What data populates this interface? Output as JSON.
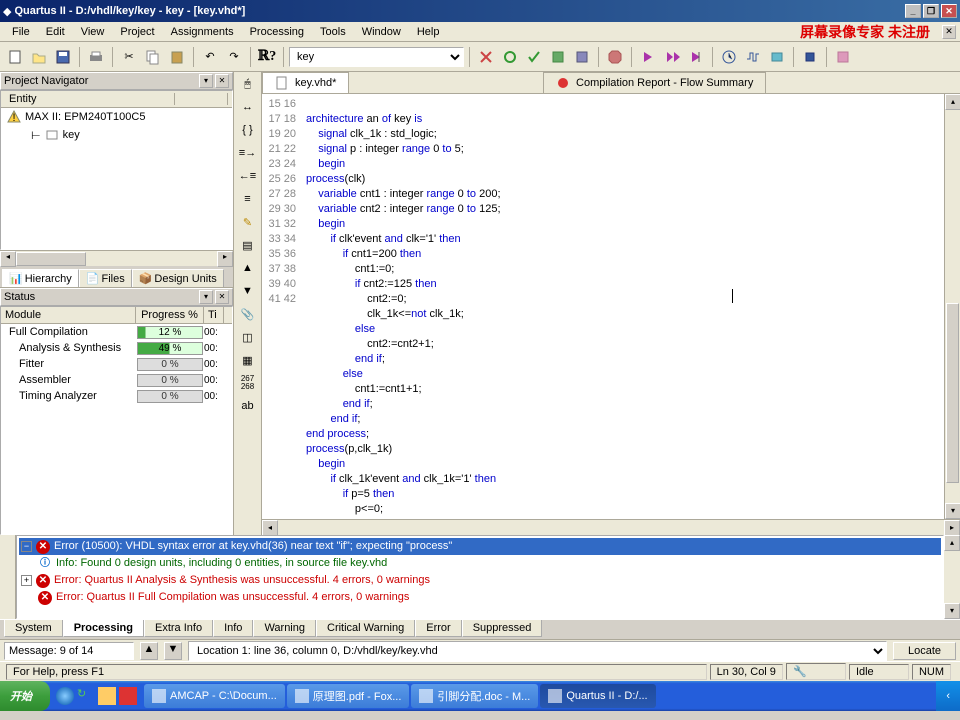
{
  "window": {
    "title": "Quartus II - D:/vhdl/key/key - key - [key.vhd*]"
  },
  "menu": {
    "items": [
      "File",
      "Edit",
      "View",
      "Project",
      "Assignments",
      "Processing",
      "Tools",
      "Window",
      "Help"
    ],
    "brand": "屏幕录像专家 未注册"
  },
  "toolbar": {
    "file_selector": "key"
  },
  "project_nav": {
    "title": "Project Navigator",
    "entity_header": "Entity",
    "device": "MAX II: EPM240T100C5",
    "entity": "key",
    "tabs": [
      "Hierarchy",
      "Files",
      "Design Units"
    ]
  },
  "status": {
    "title": "Status",
    "headers": [
      "Module",
      "Progress %",
      "Ti"
    ],
    "rows": [
      {
        "name": "Full Compilation",
        "progress": "12 %",
        "cls": "green",
        "time": "00:"
      },
      {
        "name": "Analysis & Synthesis",
        "progress": "49 %",
        "cls": "green2",
        "time": "00:",
        "indent": true
      },
      {
        "name": "Fitter",
        "progress": "0 %",
        "cls": "grey",
        "time": "00:",
        "indent": true
      },
      {
        "name": "Assembler",
        "progress": "0 %",
        "cls": "grey",
        "time": "00:",
        "indent": true
      },
      {
        "name": "Timing Analyzer",
        "progress": "0 %",
        "cls": "grey",
        "time": "00:",
        "indent": true
      }
    ]
  },
  "editor": {
    "tabs": [
      {
        "label": "key.vhd*",
        "active": true
      },
      {
        "label": "Compilation Report - Flow Summary",
        "active": false
      }
    ],
    "line_start": 15,
    "line_end": 42,
    "code_lines": [
      "",
      "<span class='kw'>architecture</span> an <span class='kw'>of</span> key <span class='kw'>is</span>",
      "    <span class='kw'>signal</span> clk_1k : std_logic;",
      "    <span class='kw'>signal</span> p : integer <span class='kw'>range</span> 0 <span class='kw'>to</span> 5;",
      "    <span class='kw'>begin</span>",
      "<span class='kw'>process</span>(clk)",
      "    <span class='kw'>variable</span> cnt1 : integer <span class='kw'>range</span> 0 <span class='kw'>to</span> 200;",
      "    <span class='kw'>variable</span> cnt2 : integer <span class='kw'>range</span> 0 <span class='kw'>to</span> 125;",
      "    <span class='kw'>begin</span>",
      "        <span class='kw'>if</span> clk'event <span class='kw'>and</span> clk='1' <span class='kw'>then</span>",
      "            <span class='kw'>if</span> cnt1=200 <span class='kw'>then</span>",
      "                cnt1:=0;",
      "                <span class='kw'>if</span> cnt2:=125 <span class='kw'>then</span>",
      "                    cnt2:=0;",
      "                    clk_1k<=<span class='kw'>not</span> clk_1k;",
      "                <span class='kw'>else</span>",
      "                    cnt2:=cnt2+1;",
      "                <span class='kw'>end</span> <span class='kw'>if</span>;",
      "            <span class='kw'>else</span>",
      "                cnt1:=cnt1+1;",
      "            <span class='kw'>end</span> <span class='kw'>if</span>;",
      "        <span class='kw'>end</span> <span class='kw'>if</span>;",
      "<span class='kw'>end</span> <span class='kw'>process</span>;",
      "<span class='kw'>process</span>(p,clk_1k)",
      "    <span class='kw'>begin</span>",
      "        <span class='kw'>if</span> clk_1k'event <span class='kw'>and</span> clk_1k='1' <span class='kw'>then</span>",
      "            <span class='kw'>if</span> p=5 <span class='kw'>then</span>",
      "                p<=0;"
    ]
  },
  "vtoolbar_small": "267\n268",
  "messages": {
    "lines": [
      {
        "type": "error",
        "hl": true,
        "expand": "",
        "text": "Error (10500): VHDL syntax error at key.vhd(36) near text \"if\";  expecting \"process\""
      },
      {
        "type": "info",
        "text": "Info: Found 0 design units, including 0 entities, in source file key.vhd"
      },
      {
        "type": "error",
        "expand": "+",
        "text": "Error: Quartus II Analysis & Synthesis was unsuccessful. 4 errors, 0 warnings"
      },
      {
        "type": "error",
        "text": "Error: Quartus II Full Compilation was unsuccessful. 4 errors, 0 warnings"
      }
    ],
    "tabs": [
      "System",
      "Processing",
      "Extra Info",
      "Info",
      "Warning",
      "Critical Warning",
      "Error",
      "Suppressed"
    ],
    "active_tab": 1
  },
  "bottom": {
    "msg_count": "Message: 9 of 14",
    "location": "Location 1: line 36, column 0, D:/vhdl/key/key.vhd",
    "locate": "Locate"
  },
  "statusbar": {
    "help": "For Help, press F1",
    "pos": "Ln 30, Col 9",
    "idle": "Idle",
    "num": "NUM"
  },
  "taskbar": {
    "start": "开始",
    "tasks": [
      "AMCAP - C:\\Docum...",
      "原理图.pdf - Fox...",
      "引脚分配.doc - M...",
      "Quartus II - D:/..."
    ],
    "active_task": 3
  }
}
